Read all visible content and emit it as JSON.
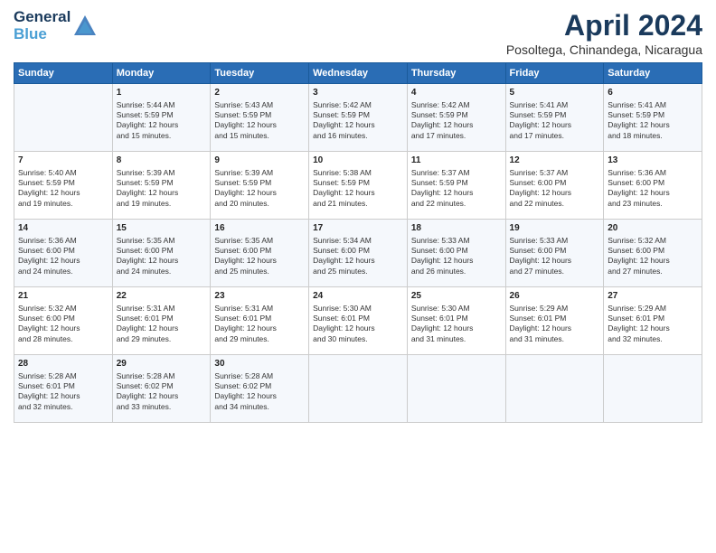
{
  "header": {
    "logo_line1": "General",
    "logo_line2": "Blue",
    "month": "April 2024",
    "location": "Posoltega, Chinandega, Nicaragua"
  },
  "days_of_week": [
    "Sunday",
    "Monday",
    "Tuesday",
    "Wednesday",
    "Thursday",
    "Friday",
    "Saturday"
  ],
  "weeks": [
    [
      {
        "day": "",
        "info": ""
      },
      {
        "day": "1",
        "info": "Sunrise: 5:44 AM\nSunset: 5:59 PM\nDaylight: 12 hours\nand 15 minutes."
      },
      {
        "day": "2",
        "info": "Sunrise: 5:43 AM\nSunset: 5:59 PM\nDaylight: 12 hours\nand 15 minutes."
      },
      {
        "day": "3",
        "info": "Sunrise: 5:42 AM\nSunset: 5:59 PM\nDaylight: 12 hours\nand 16 minutes."
      },
      {
        "day": "4",
        "info": "Sunrise: 5:42 AM\nSunset: 5:59 PM\nDaylight: 12 hours\nand 17 minutes."
      },
      {
        "day": "5",
        "info": "Sunrise: 5:41 AM\nSunset: 5:59 PM\nDaylight: 12 hours\nand 17 minutes."
      },
      {
        "day": "6",
        "info": "Sunrise: 5:41 AM\nSunset: 5:59 PM\nDaylight: 12 hours\nand 18 minutes."
      }
    ],
    [
      {
        "day": "7",
        "info": "Sunrise: 5:40 AM\nSunset: 5:59 PM\nDaylight: 12 hours\nand 19 minutes."
      },
      {
        "day": "8",
        "info": "Sunrise: 5:39 AM\nSunset: 5:59 PM\nDaylight: 12 hours\nand 19 minutes."
      },
      {
        "day": "9",
        "info": "Sunrise: 5:39 AM\nSunset: 5:59 PM\nDaylight: 12 hours\nand 20 minutes."
      },
      {
        "day": "10",
        "info": "Sunrise: 5:38 AM\nSunset: 5:59 PM\nDaylight: 12 hours\nand 21 minutes."
      },
      {
        "day": "11",
        "info": "Sunrise: 5:37 AM\nSunset: 5:59 PM\nDaylight: 12 hours\nand 22 minutes."
      },
      {
        "day": "12",
        "info": "Sunrise: 5:37 AM\nSunset: 6:00 PM\nDaylight: 12 hours\nand 22 minutes."
      },
      {
        "day": "13",
        "info": "Sunrise: 5:36 AM\nSunset: 6:00 PM\nDaylight: 12 hours\nand 23 minutes."
      }
    ],
    [
      {
        "day": "14",
        "info": "Sunrise: 5:36 AM\nSunset: 6:00 PM\nDaylight: 12 hours\nand 24 minutes."
      },
      {
        "day": "15",
        "info": "Sunrise: 5:35 AM\nSunset: 6:00 PM\nDaylight: 12 hours\nand 24 minutes."
      },
      {
        "day": "16",
        "info": "Sunrise: 5:35 AM\nSunset: 6:00 PM\nDaylight: 12 hours\nand 25 minutes."
      },
      {
        "day": "17",
        "info": "Sunrise: 5:34 AM\nSunset: 6:00 PM\nDaylight: 12 hours\nand 25 minutes."
      },
      {
        "day": "18",
        "info": "Sunrise: 5:33 AM\nSunset: 6:00 PM\nDaylight: 12 hours\nand 26 minutes."
      },
      {
        "day": "19",
        "info": "Sunrise: 5:33 AM\nSunset: 6:00 PM\nDaylight: 12 hours\nand 27 minutes."
      },
      {
        "day": "20",
        "info": "Sunrise: 5:32 AM\nSunset: 6:00 PM\nDaylight: 12 hours\nand 27 minutes."
      }
    ],
    [
      {
        "day": "21",
        "info": "Sunrise: 5:32 AM\nSunset: 6:00 PM\nDaylight: 12 hours\nand 28 minutes."
      },
      {
        "day": "22",
        "info": "Sunrise: 5:31 AM\nSunset: 6:01 PM\nDaylight: 12 hours\nand 29 minutes."
      },
      {
        "day": "23",
        "info": "Sunrise: 5:31 AM\nSunset: 6:01 PM\nDaylight: 12 hours\nand 29 minutes."
      },
      {
        "day": "24",
        "info": "Sunrise: 5:30 AM\nSunset: 6:01 PM\nDaylight: 12 hours\nand 30 minutes."
      },
      {
        "day": "25",
        "info": "Sunrise: 5:30 AM\nSunset: 6:01 PM\nDaylight: 12 hours\nand 31 minutes."
      },
      {
        "day": "26",
        "info": "Sunrise: 5:29 AM\nSunset: 6:01 PM\nDaylight: 12 hours\nand 31 minutes."
      },
      {
        "day": "27",
        "info": "Sunrise: 5:29 AM\nSunset: 6:01 PM\nDaylight: 12 hours\nand 32 minutes."
      }
    ],
    [
      {
        "day": "28",
        "info": "Sunrise: 5:28 AM\nSunset: 6:01 PM\nDaylight: 12 hours\nand 32 minutes."
      },
      {
        "day": "29",
        "info": "Sunrise: 5:28 AM\nSunset: 6:02 PM\nDaylight: 12 hours\nand 33 minutes."
      },
      {
        "day": "30",
        "info": "Sunrise: 5:28 AM\nSunset: 6:02 PM\nDaylight: 12 hours\nand 34 minutes."
      },
      {
        "day": "",
        "info": ""
      },
      {
        "day": "",
        "info": ""
      },
      {
        "day": "",
        "info": ""
      },
      {
        "day": "",
        "info": ""
      }
    ]
  ]
}
